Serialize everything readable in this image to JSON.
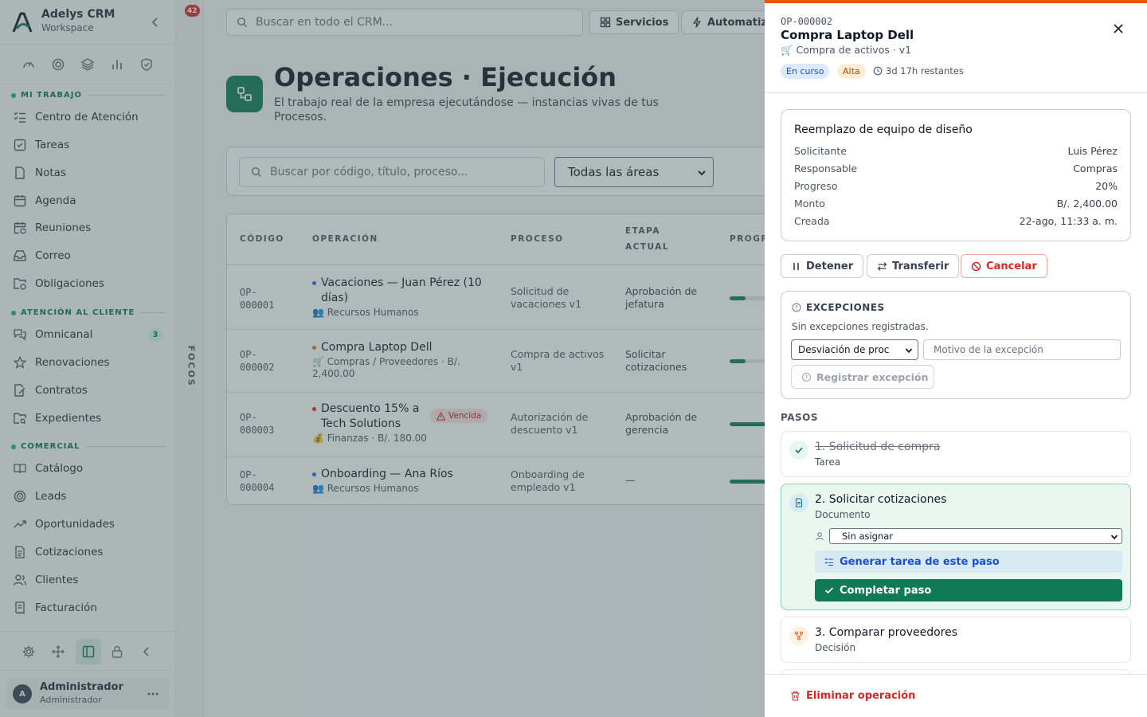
{
  "brand": {
    "name": "Adelys CRM",
    "workspace": "Workspace"
  },
  "quick_icons": [
    "dashboard-icon",
    "target-icon",
    "layers-icon",
    "bar-chart-icon",
    "shield-check-icon"
  ],
  "sidebar": {
    "sections": [
      {
        "label": "MI TRABAJO"
      },
      {
        "label": "ATENCIÓN AL CLIENTE"
      },
      {
        "label": "COMERCIAL"
      }
    ],
    "items": [
      {
        "label": "Centro de Atención",
        "icon": "list-checks-icon"
      },
      {
        "label": "Tareas",
        "icon": "square-check-icon"
      },
      {
        "label": "Notas",
        "icon": "file-icon"
      },
      {
        "label": "Agenda",
        "icon": "calendar-icon"
      },
      {
        "label": "Reuniones",
        "icon": "calendar-clock-icon"
      },
      {
        "label": "Correo",
        "icon": "inbox-icon"
      },
      {
        "label": "Obligaciones",
        "icon": "folder-clock-icon"
      },
      {
        "label": "Omnicanal",
        "icon": "messages-icon",
        "badge": "3"
      },
      {
        "label": "Renovaciones",
        "icon": "star-icon"
      },
      {
        "label": "Contratos",
        "icon": "file-signature-icon"
      },
      {
        "label": "Expedientes",
        "icon": "folder-search-icon"
      },
      {
        "label": "Catálogo",
        "icon": "book-open-icon"
      },
      {
        "label": "Leads",
        "icon": "target-icon"
      },
      {
        "label": "Oportunidades",
        "icon": "trending-up-icon"
      },
      {
        "label": "Cotizaciones",
        "icon": "file-text-icon"
      },
      {
        "label": "Clientes",
        "icon": "users-icon"
      },
      {
        "label": "Facturación",
        "icon": "receipt-icon"
      }
    ]
  },
  "bottom_tools": [
    "settings-icon",
    "move-icon",
    "panel-icon",
    "lock-icon",
    "chevron-left-icon"
  ],
  "user": {
    "initial": "A",
    "name": "Administrador",
    "role": "Administrador"
  },
  "focus_rail": {
    "badge": "42",
    "label": "FOCOS"
  },
  "topbar": {
    "search_placeholder": "Buscar en todo el CRM...",
    "services_label": "Servicios",
    "automation_label": "Automatiz"
  },
  "page": {
    "title": "Operaciones · Ejecución",
    "subtitle": "El trabajo real de la empresa ejecutándose — instancias vivas de tus Procesos."
  },
  "filters": {
    "search_placeholder": "Buscar por código, título, proceso...",
    "area_selected": "Todas las áreas"
  },
  "table": {
    "headers": {
      "code": "CÓDIGO",
      "operation": "OPERACIÓN",
      "process": "PROCESO",
      "stage_1": "ETAPA",
      "stage_2": "ACTUAL",
      "progress": "PROGR"
    },
    "rows": [
      {
        "code_1": "OP-",
        "code_2": "000001",
        "title": "Vacaciones — Juan Pérez (10 días)",
        "status_color": "#2563eb",
        "sub": "👥 Recursos Humanos",
        "process": "Solicitud de vacaciones v1",
        "stage": "Aprobación de jefatura",
        "progress": 0.2
      },
      {
        "code_1": "OP-",
        "code_2": "000002",
        "title": "Compra Laptop Dell",
        "status_color": "#d97706",
        "sub": "🛒 Compras / Proveedores · B/. 2,400.00",
        "process": "Compra de activos v1",
        "stage": "Solicitar cotizaciones",
        "progress": 0.2
      },
      {
        "code_1": "OP-",
        "code_2": "000003",
        "title": "Descuento 15% a Tech Solutions",
        "status_color": "#dc2626",
        "sub": "💰 Finanzas · B/. 180.00",
        "badge": "Vencida",
        "process": "Autorización de descuento v1",
        "stage": "Aprobación de gerencia",
        "progress": 0.5
      },
      {
        "code_1": "OP-",
        "code_2": "000004",
        "title": "Onboarding — Ana Ríos",
        "status_color": "#2563eb",
        "sub": "👥 Recursos Humanos",
        "process": "Onboarding de empleado v1",
        "stage": "—",
        "progress": 0.5
      }
    ]
  },
  "detail": {
    "code": "OP-000002",
    "title": "Compra Laptop Dell",
    "subtitle": "🛒 Compra de activos · v1",
    "status": "En curso",
    "priority": "Alta",
    "time_left": "3d 17h restantes",
    "accent_color": "#ea580c",
    "info": {
      "heading": "Reemplazo de equipo de diseño",
      "rows": [
        {
          "k": "Solicitante",
          "v": "Luis Pérez"
        },
        {
          "k": "Responsable",
          "v": "Compras"
        },
        {
          "k": "Progreso",
          "v": "20%"
        },
        {
          "k": "Monto",
          "v": "B/. 2,400.00"
        },
        {
          "k": "Creada",
          "v": "22-ago, 11:33 a. m."
        }
      ]
    },
    "actions": {
      "stop": "Detener",
      "transfer": "Transferir",
      "cancel": "Cancelar"
    },
    "exceptions": {
      "title": "EXCEPCIONES",
      "empty": "Sin excepciones registradas.",
      "type_selected": "Desviación de proc",
      "reason_placeholder": "Motivo de la excepción",
      "register": "Registrar excepción"
    },
    "steps_label": "PASOS",
    "steps": [
      {
        "title": "1. Solicitud de compra",
        "type": "Tarea",
        "state": "done"
      },
      {
        "title": "2. Solicitar cotizaciones",
        "type": "Documento",
        "state": "active",
        "assignee": "Sin asignar",
        "generate": "Generar tarea de este paso",
        "complete": "Completar paso"
      },
      {
        "title": "3. Comparar proveedores",
        "type": "Decisión",
        "state": "pending"
      }
    ],
    "delete": "Eliminar operación"
  }
}
